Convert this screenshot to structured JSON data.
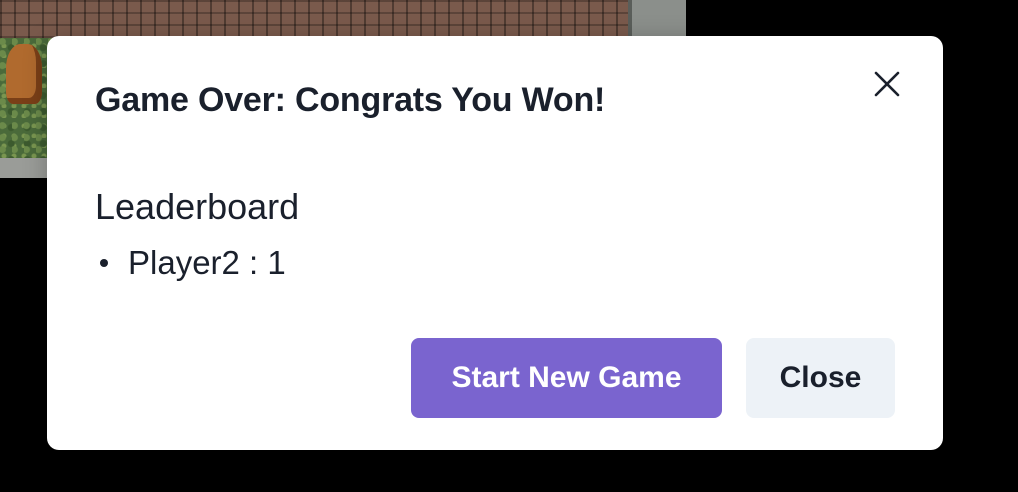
{
  "modal": {
    "title": "Game Over: Congrats You Won!",
    "close_icon": "close-icon"
  },
  "leaderboard": {
    "heading": "Leaderboard",
    "entries": [
      {
        "text": "Player2 : 1"
      }
    ]
  },
  "actions": {
    "start_new_game_label": "Start New Game",
    "close_label": "Close"
  },
  "colors": {
    "primary_button": "#7a64cf",
    "secondary_button": "#edf2f7",
    "text": "#1a202c",
    "backdrop": "#000000"
  }
}
